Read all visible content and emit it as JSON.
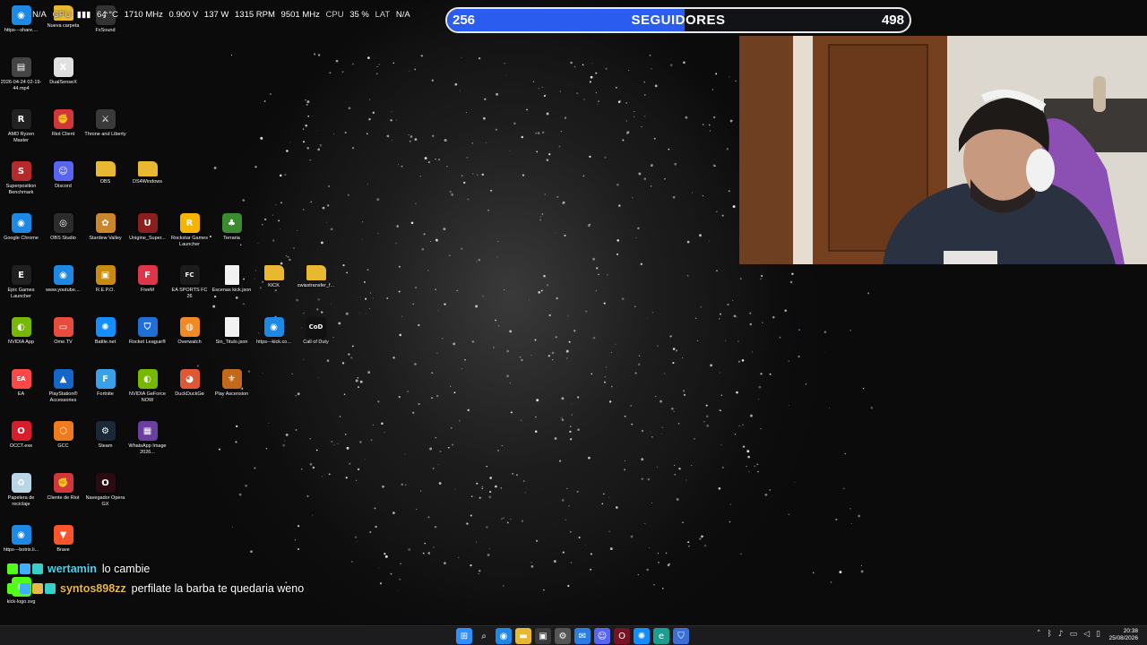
{
  "perf_overlay": {
    "lead": "N/A",
    "gpu_label": "GPU",
    "gpu_temp": "64 °C",
    "gpu_clock": "1710 MHz",
    "gpu_voltage": "0.900 V",
    "gpu_power": "137 W",
    "gpu_fan": "1315 RPM",
    "gpu_mem_clock": "9501 MHz",
    "cpu_label": "CPU",
    "cpu_load": "35 %",
    "lat_label": "LAT",
    "lat_value": "N/A"
  },
  "follower_goal": {
    "current": "256",
    "title": "SEGUIDORES",
    "target": "498",
    "progress_fraction": 0.514,
    "bar_color": "#2a5cf0"
  },
  "desktop_icons": [
    {
      "label": "https---share....",
      "icon": "chrome-icon",
      "color": "#1e88e5",
      "glyph": "◉"
    },
    {
      "label": "Nueva carpeta",
      "icon": "folder-icon",
      "color": "#e8b930",
      "glyph": ""
    },
    {
      "label": "FxSound",
      "icon": "fxsound-icon",
      "color": "#333333",
      "glyph": "♪"
    },
    {
      "label": "2026-04-24 02-19-44.mp4",
      "icon": "video-file-icon",
      "color": "#444444",
      "glyph": "▤"
    },
    {
      "label": "DualSenseX",
      "icon": "dualsensex-icon",
      "color": "#e0e0e0",
      "glyph": "X"
    },
    {
      "label": "AMD Ryzen Master",
      "icon": "ryzen-master-icon",
      "color": "#222222",
      "glyph": "R"
    },
    {
      "label": "Riot Client",
      "icon": "riot-client-icon",
      "color": "#d13639",
      "glyph": "✊"
    },
    {
      "label": "Throne and Liberty",
      "icon": "throne-liberty-icon",
      "color": "#3a3a3a",
      "glyph": "⚔"
    },
    {
      "label": "Superposition Benchmark",
      "icon": "superposition-icon",
      "color": "#b52a2a",
      "glyph": "S"
    },
    {
      "label": "Discord",
      "icon": "discord-icon",
      "color": "#5865f2",
      "glyph": "☺"
    },
    {
      "label": "OBS",
      "icon": "folder-icon",
      "color": "#e8b930",
      "glyph": ""
    },
    {
      "label": "DS4Windows",
      "icon": "folder-icon",
      "color": "#e8b930",
      "glyph": ""
    },
    {
      "label": "Google Chrome",
      "icon": "chrome-icon",
      "color": "#1e88e5",
      "glyph": "◉"
    },
    {
      "label": "OBS Studio",
      "icon": "obs-studio-icon",
      "color": "#2b2b2b",
      "glyph": "◎"
    },
    {
      "label": "Stardew Valley",
      "icon": "stardew-valley-icon",
      "color": "#c9862b",
      "glyph": "✿"
    },
    {
      "label": "Unigine_Super...",
      "icon": "unigine-icon",
      "color": "#8a1f1f",
      "glyph": "U"
    },
    {
      "label": "Rockstar Games Launcher",
      "icon": "rockstar-icon",
      "color": "#f5b400",
      "glyph": "R"
    },
    {
      "label": "Terraria",
      "icon": "terraria-icon",
      "color": "#3a8c2f",
      "glyph": "♣"
    },
    {
      "label": "Epic Games Launcher",
      "icon": "epic-games-icon",
      "color": "#202020",
      "glyph": "E"
    },
    {
      "label": "www.youtube....",
      "icon": "chrome-icon",
      "color": "#1e88e5",
      "glyph": "◉"
    },
    {
      "label": "R.E.P.O.",
      "icon": "repo-game-icon",
      "color": "#c98a12",
      "glyph": "▣"
    },
    {
      "label": "FiveM",
      "icon": "fivem-icon",
      "color": "#e0344a",
      "glyph": "F"
    },
    {
      "label": "EA SPORTS FC 26",
      "icon": "ea-fc-icon",
      "color": "#1b1b1b",
      "glyph": "FC"
    },
    {
      "label": "Escenas kick.json",
      "icon": "json-file-icon",
      "color": "#f2f2f2",
      "glyph": ""
    },
    {
      "label": "KICK",
      "icon": "folder-icon",
      "color": "#e8b930",
      "glyph": ""
    },
    {
      "label": "swisstransfer_f...",
      "icon": "folder-icon",
      "color": "#e8b930",
      "glyph": ""
    },
    {
      "label": "NVIDIA App",
      "icon": "nvidia-icon",
      "color": "#76b900",
      "glyph": "◐"
    },
    {
      "label": "Ome.TV",
      "icon": "ometv-icon",
      "color": "#e74c3c",
      "glyph": "▭"
    },
    {
      "label": "Battle.net",
      "icon": "battlenet-icon",
      "color": "#148eff",
      "glyph": "✺"
    },
    {
      "label": "Rocket League®",
      "icon": "rocket-league-icon",
      "color": "#1f6fd6",
      "glyph": "⛉"
    },
    {
      "label": "Overwatch",
      "icon": "overwatch-icon",
      "color": "#f08a24",
      "glyph": "◍"
    },
    {
      "label": "Sin_Titulo.json",
      "icon": "json-file-icon",
      "color": "#f2f2f2",
      "glyph": ""
    },
    {
      "label": "https---kick.co...",
      "icon": "chrome-icon",
      "color": "#1e88e5",
      "glyph": "◉"
    },
    {
      "label": "Call of Duty",
      "icon": "call-of-duty-icon",
      "color": "#111111",
      "glyph": "CoD"
    },
    {
      "label": "EA",
      "icon": "ea-icon",
      "color": "#ff4747",
      "glyph": "EA"
    },
    {
      "label": "PlayStation® Accessories",
      "icon": "playstation-icon",
      "color": "#1466c8",
      "glyph": "▲"
    },
    {
      "label": "Fortnite",
      "icon": "fortnite-icon",
      "color": "#3aa0e8",
      "glyph": "F"
    },
    {
      "label": "NVIDIA GeForce NOW",
      "icon": "geforce-now-icon",
      "color": "#76b900",
      "glyph": "◐"
    },
    {
      "label": "DuckDuckGo",
      "icon": "duckduckgo-icon",
      "color": "#de5833",
      "glyph": "◕"
    },
    {
      "label": "Play Ascension",
      "icon": "ascension-icon",
      "color": "#c26a1a",
      "glyph": "⚜"
    },
    {
      "label": "OCCT.exe",
      "icon": "occt-icon",
      "color": "#d91e2b",
      "glyph": "O"
    },
    {
      "label": "GCC",
      "icon": "gcc-icon",
      "color": "#f07b1c",
      "glyph": "⬡"
    },
    {
      "label": "Steam",
      "icon": "steam-icon",
      "color": "#1b2838",
      "glyph": "⚙"
    },
    {
      "label": "WhatsApp Image 2026...",
      "icon": "image-file-icon",
      "color": "#6b3fa0",
      "glyph": "▦"
    },
    {
      "label": "Papelera de reciclaje",
      "icon": "recycle-bin-icon",
      "color": "#b8d6e6",
      "glyph": "♻"
    },
    {
      "label": "Cliente de Riot",
      "icon": "riot-client-icon",
      "color": "#d13639",
      "glyph": "✊"
    },
    {
      "label": "Navegador Opera GX",
      "icon": "opera-gx-icon",
      "color": "#2a0b12",
      "glyph": "O"
    },
    {
      "label": "https---botrix.li...",
      "icon": "chrome-icon",
      "color": "#1e88e5",
      "glyph": "◉"
    },
    {
      "label": "Brave",
      "icon": "brave-icon",
      "color": "#fb542b",
      "glyph": "▼"
    },
    {
      "label": "kick-logo.svg",
      "icon": "svg-file-icon",
      "color": "#53fc18",
      "glyph": "K"
    }
  ],
  "chat": [
    {
      "user": "wertamin",
      "message": "lo cambie",
      "user_color": "#4fd1e8"
    },
    {
      "user": "syntos898zz",
      "message": "perfilate la barba te quedaria weno",
      "user_color": "#e8b84a"
    }
  ],
  "taskbar": {
    "icons": [
      "windows-start-icon",
      "search-icon",
      "chrome-icon",
      "file-explorer-icon",
      "store-icon",
      "settings-icon",
      "mail-icon",
      "discord-icon",
      "opera-gx-icon",
      "battlenet-icon",
      "edge-icon",
      "security-icon"
    ],
    "tray_icons": [
      "chevron-up-icon",
      "bluetooth-icon",
      "microphone-icon",
      "network-icon",
      "volume-icon",
      "battery-icon"
    ],
    "time": "20:38",
    "date": "25/08/2026"
  }
}
